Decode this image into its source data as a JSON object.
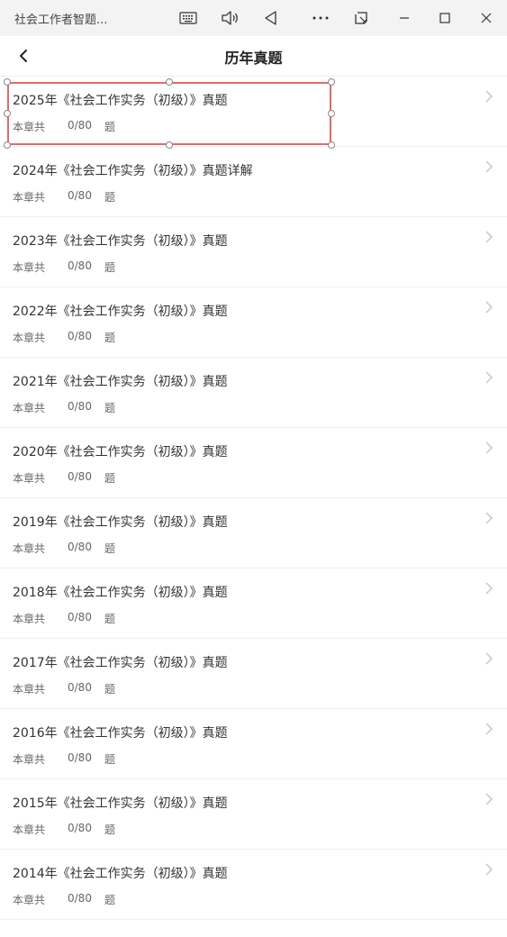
{
  "window": {
    "title": "社会工作者智题..."
  },
  "toolbar_icons": [
    "keyboard-icon",
    "volume-icon",
    "back-triangle-icon",
    "more-icon",
    "screenshot-icon",
    "minimize-icon",
    "maximize-icon",
    "close-icon"
  ],
  "header": {
    "title": "历年真题",
    "back_icon": "chevron-left-icon"
  },
  "list": {
    "items": [
      {
        "title": "2025年《社会工作实务（初级）》真题",
        "prefix": "本章共",
        "count": "0/80",
        "unit": "题"
      },
      {
        "title": "2024年《社会工作实务（初级）》真题详解",
        "prefix": "本章共",
        "count": "0/80",
        "unit": "题"
      },
      {
        "title": "2023年《社会工作实务（初级）》真题",
        "prefix": "本章共",
        "count": "0/80",
        "unit": "题"
      },
      {
        "title": "2022年《社会工作实务（初级）》真题",
        "prefix": "本章共",
        "count": "0/80",
        "unit": "题"
      },
      {
        "title": "2021年《社会工作实务（初级）》真题",
        "prefix": "本章共",
        "count": "0/80",
        "unit": "题"
      },
      {
        "title": "2020年《社会工作实务（初级）》真题",
        "prefix": "本章共",
        "count": "0/80",
        "unit": "题"
      },
      {
        "title": "2019年《社会工作实务（初级）》真题",
        "prefix": "本章共",
        "count": "0/80",
        "unit": "题"
      },
      {
        "title": "2018年《社会工作实务（初级）》真题",
        "prefix": "本章共",
        "count": "0/80",
        "unit": "题"
      },
      {
        "title": "2017年《社会工作实务（初级）》真题",
        "prefix": "本章共",
        "count": "0/80",
        "unit": "题"
      },
      {
        "title": "2016年《社会工作实务（初级）》真题",
        "prefix": "本章共",
        "count": "0/80",
        "unit": "题"
      },
      {
        "title": "2015年《社会工作实务（初级）》真题",
        "prefix": "本章共",
        "count": "0/80",
        "unit": "题"
      },
      {
        "title": "2014年《社会工作实务（初级）》真题",
        "prefix": "本章共",
        "count": "0/80",
        "unit": "题"
      }
    ]
  },
  "colors": {
    "selection_border": "#e26a6a",
    "titlebar_bg": "#f3f3f3"
  }
}
